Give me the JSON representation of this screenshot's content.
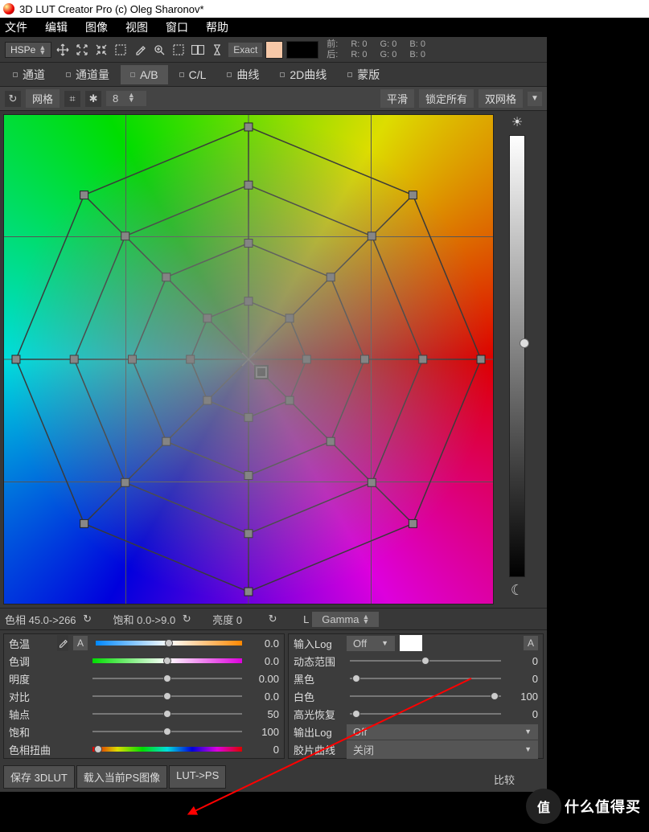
{
  "title": "3D LUT Creator Pro (c) Oleg Sharonov*",
  "menu": [
    "文件",
    "编辑",
    "图像",
    "视图",
    "窗口",
    "帮助"
  ],
  "mode_selector": "HSPe",
  "exact_btn": "Exact",
  "rgb_info": {
    "front_label": "前:",
    "back_label": "后:",
    "r_label": "R:",
    "g_label": "G:",
    "b_label": "B:",
    "front": {
      "r": "0",
      "g": "0",
      "b": "0"
    },
    "back": {
      "r": "0",
      "g": "0",
      "b": "0"
    }
  },
  "tabs": [
    "通道",
    "通道量",
    "A/B",
    "C/L",
    "曲线",
    "2D曲线",
    "蒙版"
  ],
  "active_tab": "A/B",
  "grid_opts": {
    "grid_label": "网格",
    "count": "8",
    "smooth": "平滑",
    "lock_all": "锁定所有",
    "dual_grid": "双网格"
  },
  "status": {
    "hue": "色相 45.0->266",
    "sat": "饱和 0.0->9.0",
    "lum": "亮度 0",
    "l_label": "L",
    "mode": "Gamma"
  },
  "left_sliders": [
    {
      "label": "色温",
      "val": "0.0",
      "style": "temp"
    },
    {
      "label": "色调",
      "val": "0.0",
      "style": "tint"
    },
    {
      "label": "明度",
      "val": "0.00",
      "style": "plain"
    },
    {
      "label": "对比",
      "val": "0.0",
      "style": "plain"
    },
    {
      "label": "轴点",
      "val": "50",
      "style": "plain"
    },
    {
      "label": "饱和",
      "val": "100",
      "style": "plain"
    },
    {
      "label": "色相扭曲",
      "val": "0",
      "style": "rainbow"
    }
  ],
  "right_panel": {
    "input_log": {
      "label": "输入Log",
      "value": "Off"
    },
    "dynamic": {
      "label": "动态范围",
      "val": "0"
    },
    "black": {
      "label": "黑色",
      "val": "0"
    },
    "white": {
      "label": "白色",
      "val": "100"
    },
    "highlight": {
      "label": "高光恢复",
      "val": "0"
    },
    "output_log": {
      "label": "输出Log",
      "value": "Off"
    },
    "film": {
      "label": "胶片曲线",
      "value": "关闭"
    }
  },
  "actions": {
    "save": "保存 3DLUT",
    "load": "载入当前PS图像",
    "lut_ps": "LUT->PS",
    "compare": "比较"
  },
  "a_btn": "A",
  "watermark": {
    "circle": "值",
    "text": "什么值得买"
  }
}
